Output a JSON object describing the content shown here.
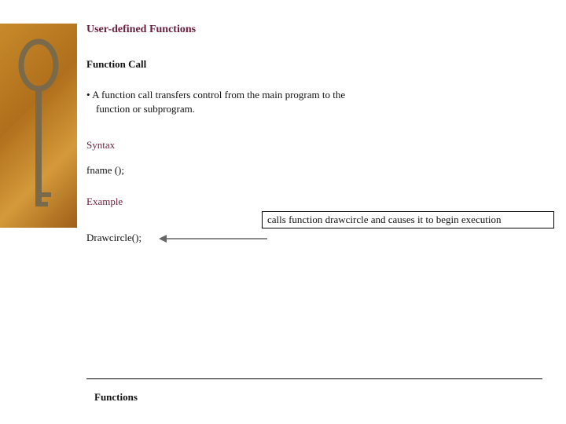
{
  "title": "User-defined Functions",
  "subtitle": "Function Call",
  "bullet": {
    "line1": "• A function call transfers control from the main program to the",
    "line2": "function or subprogram."
  },
  "syntax": {
    "label": "Syntax",
    "code": "fname ();"
  },
  "example": {
    "label": "Example",
    "code": "Drawcircle();",
    "callout": "calls function drawcircle and causes it to begin execution"
  },
  "footer": "Functions",
  "sideImage": {
    "name": "key-on-ochre-texture"
  }
}
